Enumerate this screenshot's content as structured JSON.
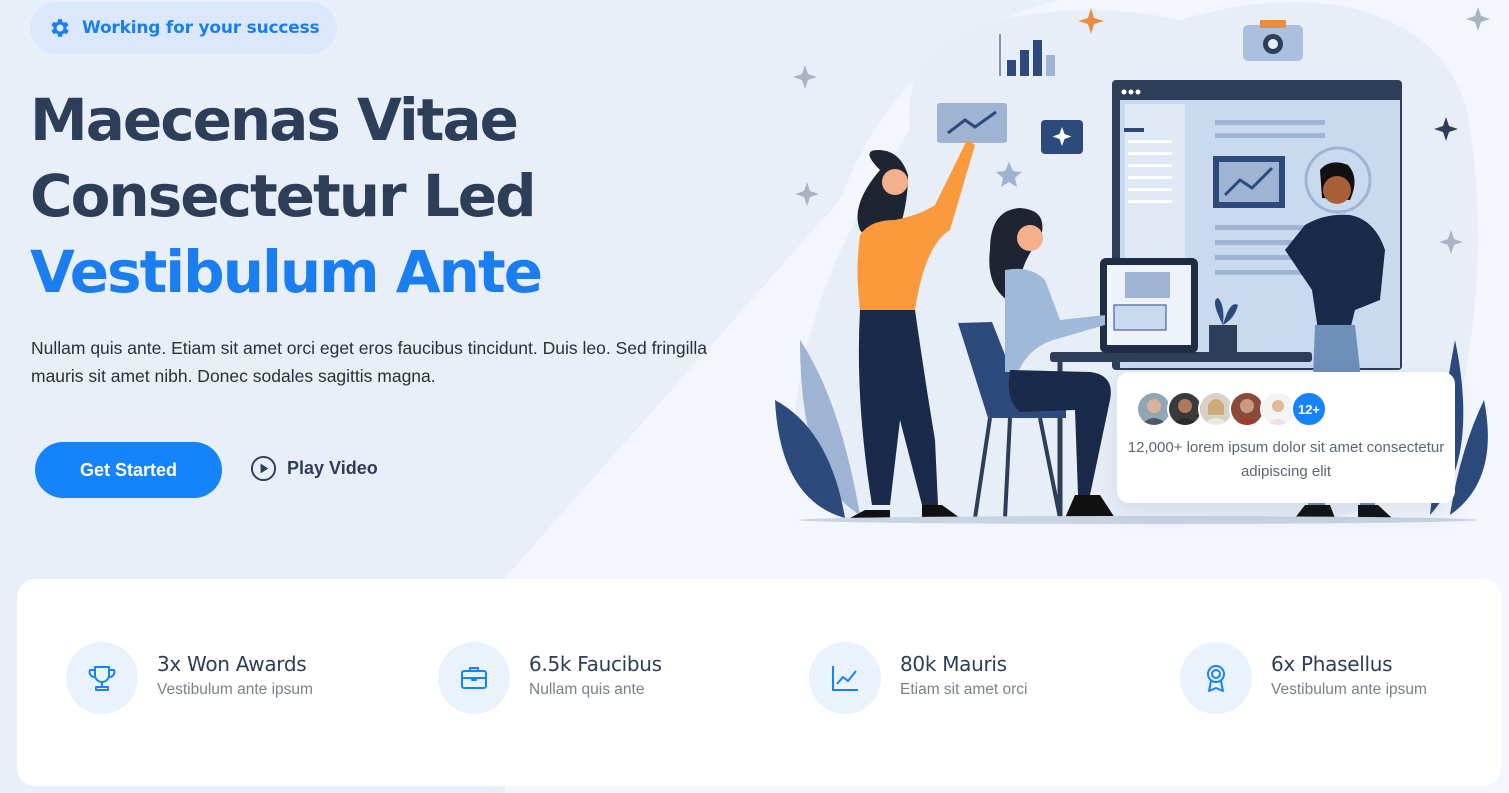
{
  "hero": {
    "badge_text": "Working for your success",
    "badge_icon": "gear-icon",
    "heading_line1": "Maecenas Vitae",
    "heading_line2": "Consectetur Led",
    "heading_line3": "Vestibulum Ante",
    "description": "Nullam quis ante. Etiam sit amet orci eget eros faucibus tincidunt. Duis leo. Sed fringilla mauris sit amet nibh. Donec sodales sagittis magna.",
    "primary_button": "Get Started",
    "secondary_button": "Play Video",
    "secondary_icon": "play-circle-icon"
  },
  "social_proof": {
    "more_badge": "12+",
    "text": "12,000+ lorem ipsum dolor sit amet consectetur adipiscing elit"
  },
  "stats": [
    {
      "icon": "trophy-icon",
      "title": "3x Won Awards",
      "subtitle": "Vestibulum ante ipsum"
    },
    {
      "icon": "briefcase-icon",
      "title": "6.5k Faucibus",
      "subtitle": "Nullam quis ante"
    },
    {
      "icon": "chart-line-icon",
      "title": "80k Mauris",
      "subtitle": "Etiam sit amet orci"
    },
    {
      "icon": "award-icon",
      "title": "6x Phasellus",
      "subtitle": "Vestibulum ante ipsum"
    }
  ],
  "colors": {
    "accent": "#1583fb",
    "heading": "#2c3e58",
    "background": "#edf2fa"
  }
}
